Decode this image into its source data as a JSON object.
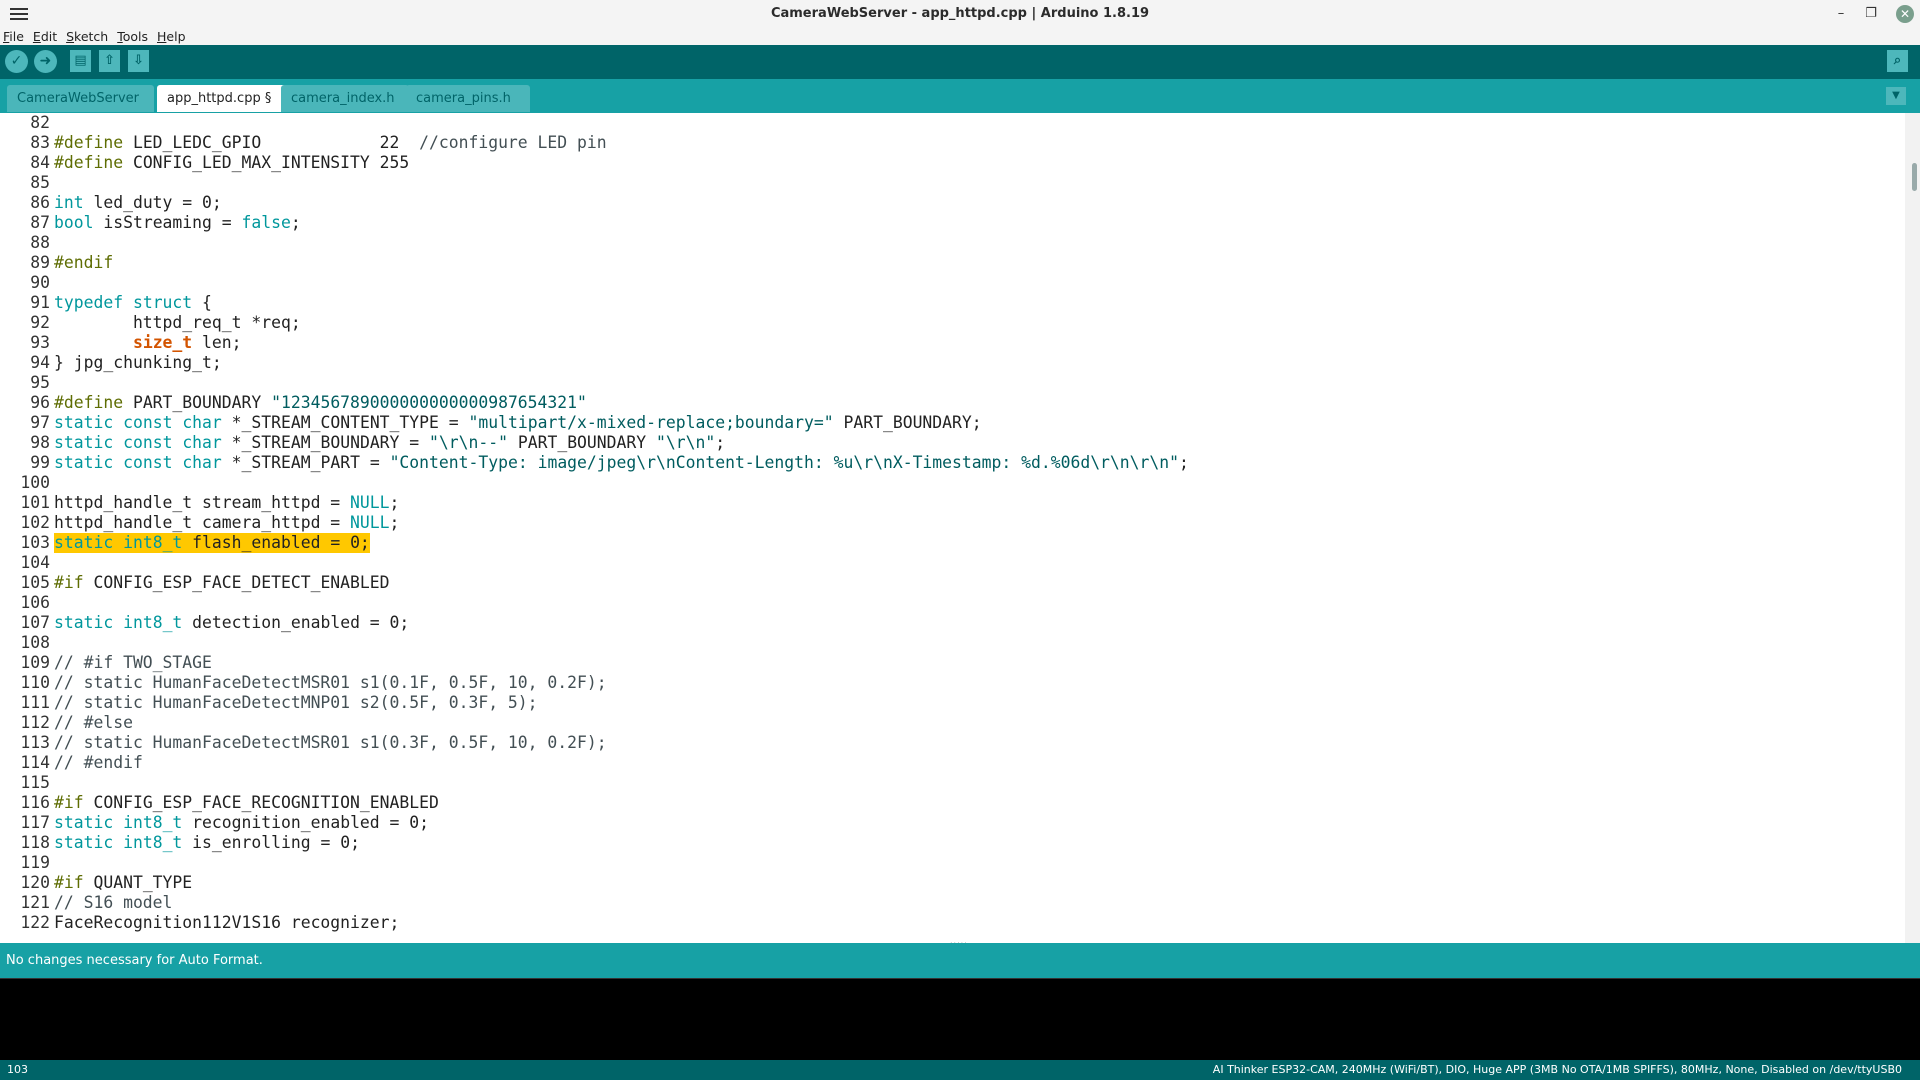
{
  "window": {
    "title": "CameraWebServer - app_httpd.cpp | Arduino 1.8.19"
  },
  "menubar": {
    "items": [
      "File",
      "Edit",
      "Sketch",
      "Tools",
      "Help"
    ]
  },
  "toolbar": {
    "verify_icon": "check-icon",
    "upload_icon": "arrow-right-icon",
    "new_icon": "new-file-icon",
    "open_icon": "arrow-up-icon",
    "save_icon": "arrow-down-icon",
    "serial_icon": "magnifier-icon"
  },
  "tabs": [
    {
      "label": "CameraWebServer §"
    },
    {
      "label": "app_httpd.cpp §"
    },
    {
      "label": "camera_index.h"
    },
    {
      "label": "camera_pins.h"
    }
  ],
  "editor": {
    "lines": [
      {
        "n": "82",
        "text": ""
      },
      {
        "n": "83",
        "text": "#define LED_LEDC_GPIO            22  //configure LED pin"
      },
      {
        "n": "84",
        "text": "#define CONFIG_LED_MAX_INTENSITY 255"
      },
      {
        "n": "85",
        "text": ""
      },
      {
        "n": "86",
        "text": "int led_duty = 0;"
      },
      {
        "n": "87",
        "text": "bool isStreaming = false;"
      },
      {
        "n": "88",
        "text": ""
      },
      {
        "n": "89",
        "text": "#endif"
      },
      {
        "n": "90",
        "text": ""
      },
      {
        "n": "91",
        "text": "typedef struct {"
      },
      {
        "n": "92",
        "text": "        httpd_req_t *req;"
      },
      {
        "n": "93",
        "text": "        size_t len;"
      },
      {
        "n": "94",
        "text": "} jpg_chunking_t;"
      },
      {
        "n": "95",
        "text": ""
      },
      {
        "n": "96",
        "text": "#define PART_BOUNDARY \"123456789000000000000987654321\""
      },
      {
        "n": "97",
        "text": "static const char *_STREAM_CONTENT_TYPE = \"multipart/x-mixed-replace;boundary=\" PART_BOUNDARY;"
      },
      {
        "n": "98",
        "text": "static const char *_STREAM_BOUNDARY = \"\\r\\n--\" PART_BOUNDARY \"\\r\\n\";"
      },
      {
        "n": "99",
        "text": "static const char *_STREAM_PART = \"Content-Type: image/jpeg\\r\\nContent-Length: %u\\r\\nX-Timestamp: %d.%06d\\r\\n\\r\\n\";"
      },
      {
        "n": "100",
        "text": ""
      },
      {
        "n": "101",
        "text": "httpd_handle_t stream_httpd = NULL;"
      },
      {
        "n": "102",
        "text": "httpd_handle_t camera_httpd = NULL;"
      },
      {
        "n": "103",
        "text": "static int8_t flash_enabled = 0;"
      },
      {
        "n": "104",
        "text": ""
      },
      {
        "n": "105",
        "text": "#if CONFIG_ESP_FACE_DETECT_ENABLED"
      },
      {
        "n": "106",
        "text": ""
      },
      {
        "n": "107",
        "text": "static int8_t detection_enabled = 0;"
      },
      {
        "n": "108",
        "text": ""
      },
      {
        "n": "109",
        "text": "// #if TWO_STAGE"
      },
      {
        "n": "110",
        "text": "// static HumanFaceDetectMSR01 s1(0.1F, 0.5F, 10, 0.2F);"
      },
      {
        "n": "111",
        "text": "// static HumanFaceDetectMNP01 s2(0.5F, 0.3F, 5);"
      },
      {
        "n": "112",
        "text": "// #else"
      },
      {
        "n": "113",
        "text": "// static HumanFaceDetectMSR01 s1(0.3F, 0.5F, 10, 0.2F);"
      },
      {
        "n": "114",
        "text": "// #endif"
      },
      {
        "n": "115",
        "text": ""
      },
      {
        "n": "116",
        "text": "#if CONFIG_ESP_FACE_RECOGNITION_ENABLED"
      },
      {
        "n": "117",
        "text": "static int8_t recognition_enabled = 0;"
      },
      {
        "n": "118",
        "text": "static int8_t is_enrolling = 0;"
      },
      {
        "n": "119",
        "text": ""
      },
      {
        "n": "120",
        "text": "#if QUANT_TYPE"
      },
      {
        "n": "121",
        "text": "// S16 model"
      },
      {
        "n": "122",
        "text": "FaceRecognition112V1S16 recognizer;"
      }
    ],
    "highlighted_line": "103"
  },
  "status": {
    "message": "No changes necessary for Auto Format."
  },
  "bottom": {
    "line_number": "103",
    "board_info": "AI Thinker ESP32-CAM, 240MHz (WiFi/BT), DIO, Huge APP (3MB No OTA/1MB SPIFFS), 80MHz, None, Disabled on /dev/ttyUSB0"
  },
  "colors": {
    "toolbar": "#006468",
    "tabbar": "#17a1a5",
    "highlight": "#ffc800"
  }
}
